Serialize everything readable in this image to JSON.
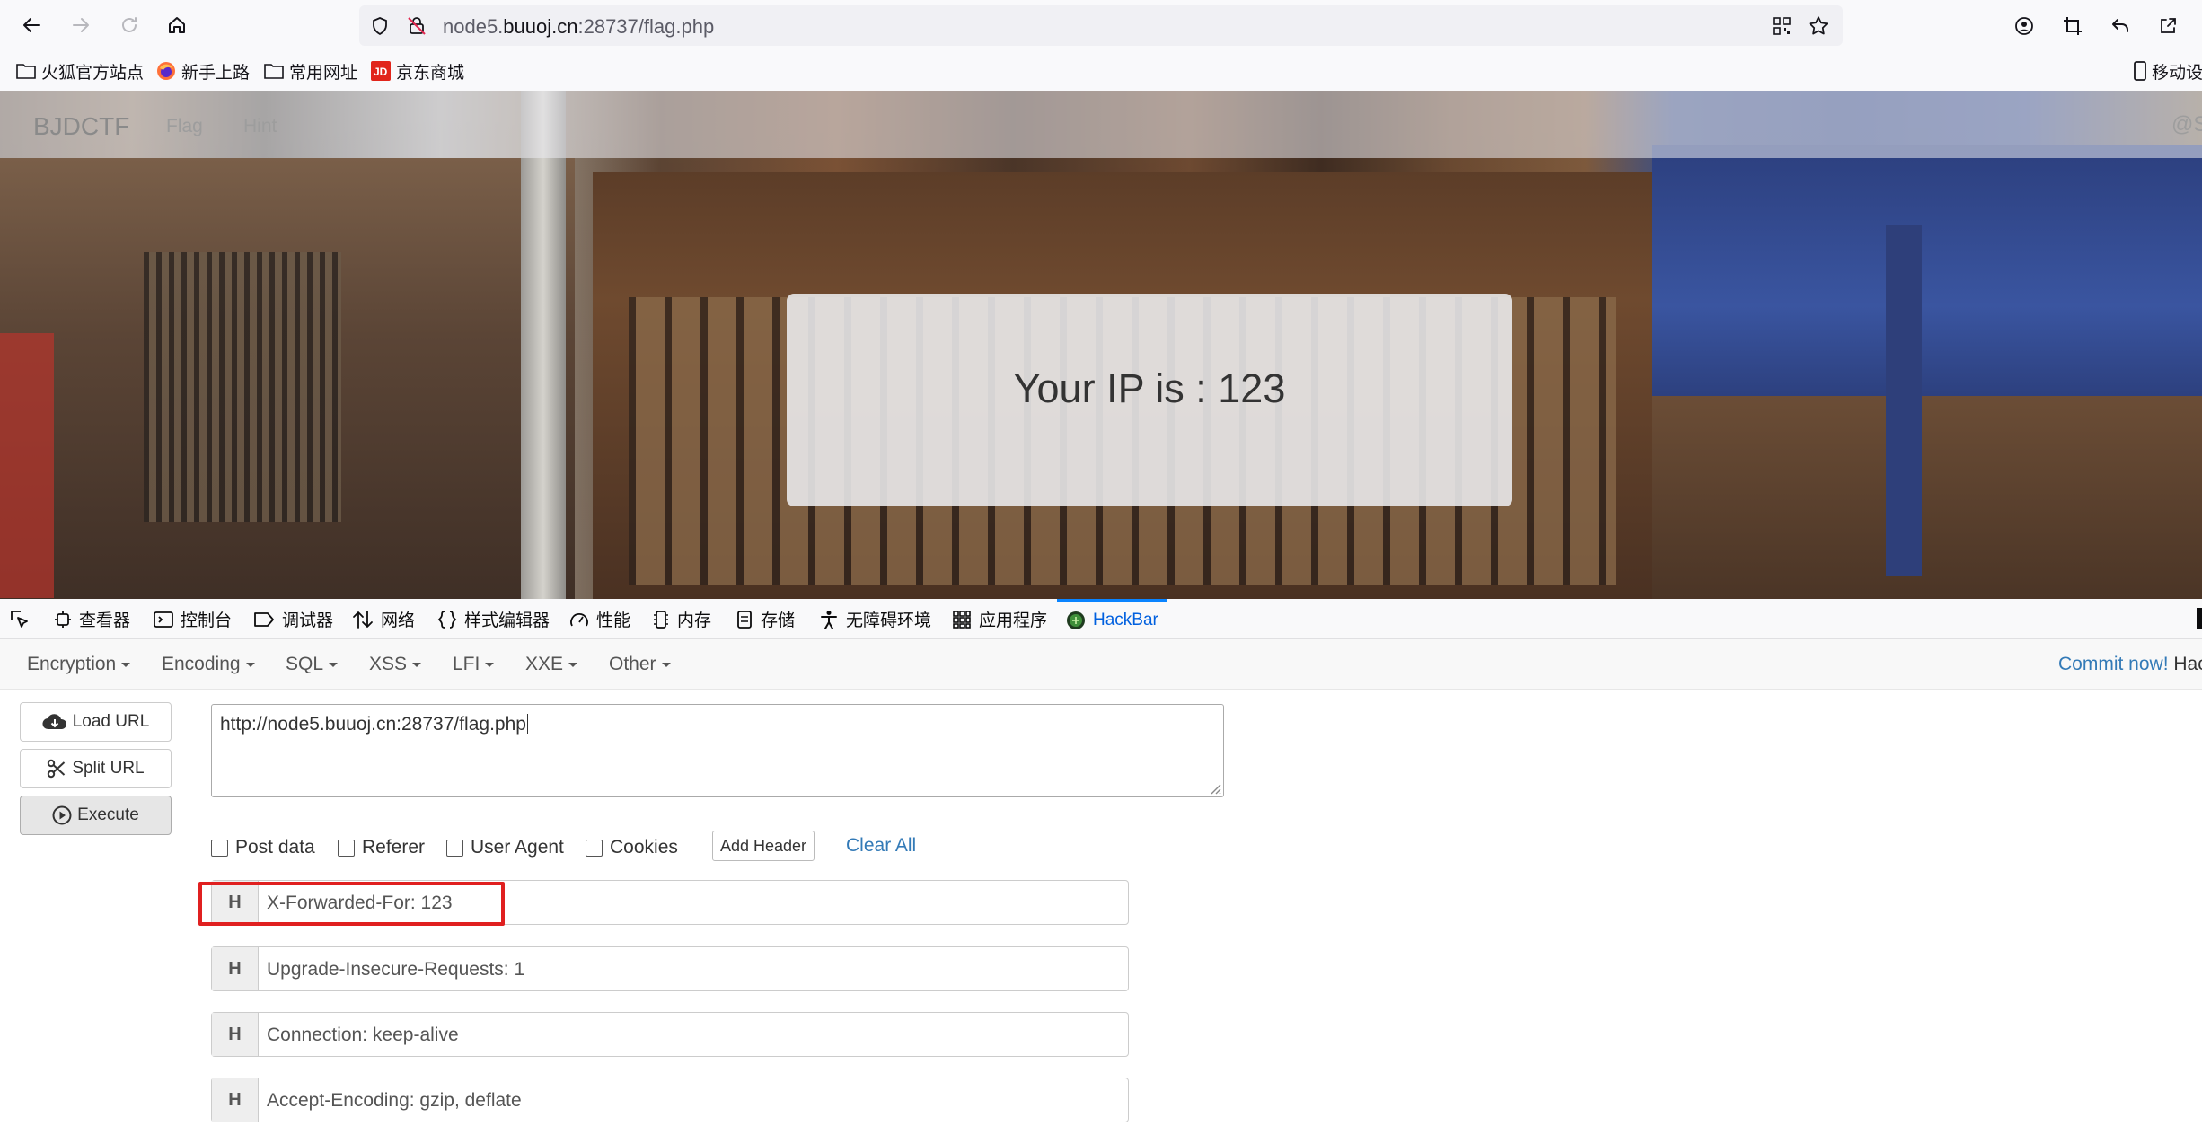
{
  "browser": {
    "url_prefix": "node5.",
    "url_host": "buuoj.cn",
    "url_suffix": ":28737/flag.php",
    "bookmarks": [
      {
        "label": "火狐官方站点",
        "icon": "folder-icon"
      },
      {
        "label": "新手上路",
        "icon": "firefox-icon"
      },
      {
        "label": "常用网址",
        "icon": "folder-icon"
      },
      {
        "label": "京东商城",
        "icon": "jd-icon"
      }
    ],
    "mobile_label": "移动设"
  },
  "site": {
    "brand": "BJDCTF",
    "nav": [
      "Flag",
      "Hint"
    ],
    "right_text": "@S",
    "ip_message": "Your IP is : 123"
  },
  "devtools": {
    "tabs": [
      {
        "label": "查看器",
        "icon": "inspector-icon"
      },
      {
        "label": "控制台",
        "icon": "console-icon"
      },
      {
        "label": "调试器",
        "icon": "debugger-icon"
      },
      {
        "label": "网络",
        "icon": "network-icon"
      },
      {
        "label": "样式编辑器",
        "icon": "style-editor-icon"
      },
      {
        "label": "性能",
        "icon": "performance-icon"
      },
      {
        "label": "内存",
        "icon": "memory-icon"
      },
      {
        "label": "存储",
        "icon": "storage-icon"
      },
      {
        "label": "无障碍环境",
        "icon": "accessibility-icon"
      },
      {
        "label": "应用程序",
        "icon": "application-icon"
      },
      {
        "label": "HackBar",
        "icon": "hackbar-icon"
      }
    ],
    "active_tab": "HackBar"
  },
  "hackbar": {
    "menu": [
      "Encryption",
      "Encoding",
      "SQL",
      "XSS",
      "LFI",
      "XXE",
      "Other"
    ],
    "commit": "Commit now!",
    "commit_tail": "Hac",
    "buttons": {
      "load": "Load URL",
      "split": "Split URL",
      "execute": "Execute"
    },
    "url_value": "http://node5.buuoj.cn:28737/flag.php",
    "options": [
      "Post data",
      "Referer",
      "User Agent",
      "Cookies"
    ],
    "add_header": "Add Header",
    "clear_all": "Clear All",
    "header_tag": "H",
    "headers": [
      "X-Forwarded-For: 123",
      "Upgrade-Insecure-Requests: 1",
      "Connection: keep-alive",
      "Accept-Encoding: gzip, deflate"
    ],
    "highlight_color": "#e02020"
  }
}
